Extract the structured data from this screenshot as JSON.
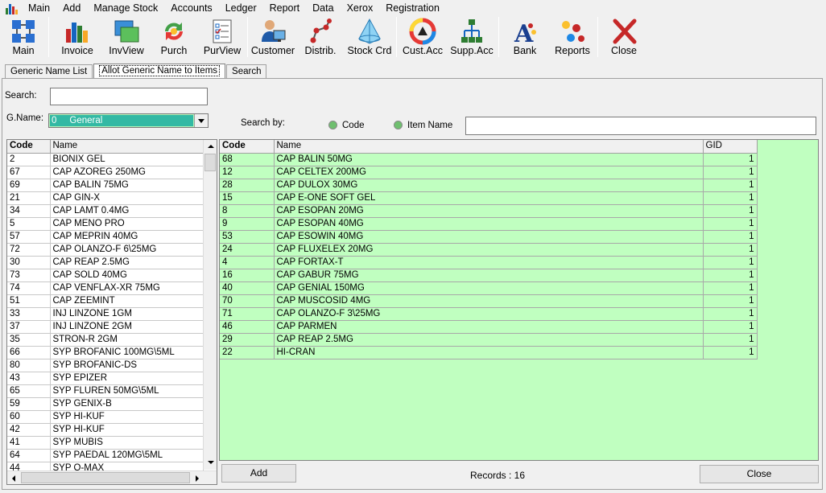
{
  "menu": [
    "Main",
    "Add",
    "Manage Stock",
    "Accounts",
    "Ledger",
    "Report",
    "Data",
    "Xerox",
    "Registration"
  ],
  "toolbar": [
    {
      "label": "Main",
      "icon": "main-icon",
      "group": 0
    },
    {
      "label": "Invoice",
      "icon": "invoice-icon",
      "group": 1
    },
    {
      "label": "InvView",
      "icon": "invview-icon",
      "group": 1
    },
    {
      "label": "Purch",
      "icon": "purch-icon",
      "group": 1
    },
    {
      "label": "PurView",
      "icon": "purview-icon",
      "group": 1
    },
    {
      "label": "Customer",
      "icon": "customer-icon",
      "group": 2
    },
    {
      "label": "Distrib.",
      "icon": "distrib-icon",
      "group": 2
    },
    {
      "label": "Stock Crd",
      "icon": "stock-crd-icon",
      "group": 2
    },
    {
      "label": "Cust.Acc",
      "icon": "cust-acc-icon",
      "group": 3
    },
    {
      "label": "Supp.Acc",
      "icon": "supp-acc-icon",
      "group": 3
    },
    {
      "label": "Bank",
      "icon": "bank-icon",
      "group": 4
    },
    {
      "label": "Reports",
      "icon": "reports-icon",
      "group": 4
    },
    {
      "label": "Close",
      "icon": "close-icon",
      "group": 5
    }
  ],
  "tabs": [
    {
      "label": "Generic Name List",
      "active": false
    },
    {
      "label": "Allot Generic Name to Items",
      "active": true
    },
    {
      "label": "Search",
      "active": false
    }
  ],
  "form": {
    "search_label": "Search:",
    "search_value": "",
    "gname_label": "G.Name:",
    "gname_value": "0     General",
    "search_by_label": "Search by:",
    "radio_code": "Code",
    "radio_item_name": "Item Name",
    "search_by_value": ""
  },
  "left_grid": {
    "columns": [
      "Code",
      "Name"
    ],
    "rows": [
      [
        "2",
        "BIONIX GEL"
      ],
      [
        "67",
        "CAP AZOREG 250MG"
      ],
      [
        "69",
        "CAP BALIN 75MG"
      ],
      [
        "21",
        "CAP GIN-X"
      ],
      [
        "34",
        "CAP LAMT 0.4MG"
      ],
      [
        "5",
        "CAP MENO PRO"
      ],
      [
        "57",
        "CAP MEPRIN 40MG"
      ],
      [
        "72",
        "CAP OLANZO-F  6\\25MG"
      ],
      [
        "30",
        "CAP REAP 2.5MG"
      ],
      [
        "73",
        "CAP SOLD 40MG"
      ],
      [
        "74",
        "CAP VENFLAX-XR 75MG"
      ],
      [
        "51",
        "CAP ZEEMINT"
      ],
      [
        "33",
        "INJ LINZONE 1GM"
      ],
      [
        "37",
        "INJ LINZONE 2GM"
      ],
      [
        "35",
        "STRON-R 2GM"
      ],
      [
        "66",
        "SYP BROFANIC 100MG\\5ML"
      ],
      [
        "80",
        "SYP BROFANIC-DS"
      ],
      [
        "43",
        "SYP EPIZER"
      ],
      [
        "65",
        "SYP FLUREN 50MG\\5ML"
      ],
      [
        "59",
        "SYP GENIX-B"
      ],
      [
        "60",
        "SYP HI-KUF"
      ],
      [
        "42",
        "SYP HI-KUF"
      ],
      [
        "41",
        "SYP MUBIS"
      ],
      [
        "64",
        "SYP PAEDAL 120MG\\5ML"
      ],
      [
        "44",
        "SYP Q-MAX"
      ]
    ]
  },
  "right_grid": {
    "columns": [
      "Code",
      "Name",
      "GID"
    ],
    "rows": [
      [
        "68",
        "CAP BALIN 50MG",
        "1"
      ],
      [
        "12",
        "CAP CELTEX 200MG",
        "1"
      ],
      [
        "28",
        "CAP DULOX 30MG",
        "1"
      ],
      [
        "15",
        "CAP E-ONE SOFT GEL",
        "1"
      ],
      [
        "8",
        "CAP ESOPAN 20MG",
        "1"
      ],
      [
        "9",
        "CAP ESOPAN 40MG",
        "1"
      ],
      [
        "53",
        "CAP ESOWIN 40MG",
        "1"
      ],
      [
        "24",
        "CAP FLUXELEX 20MG",
        "1"
      ],
      [
        "4",
        "CAP FORTAX-T",
        "1"
      ],
      [
        "16",
        "CAP GABUR 75MG",
        "1"
      ],
      [
        "40",
        "CAP GENIAL 150MG",
        "1"
      ],
      [
        "70",
        "CAP MUSCOSID 4MG",
        "1"
      ],
      [
        "71",
        "CAP OLANZO-F  3\\25MG",
        "1"
      ],
      [
        "46",
        "CAP PARMEN",
        "1"
      ],
      [
        "29",
        "CAP REAP 2.5MG",
        "1"
      ],
      [
        "22",
        "HI-CRAN",
        "1"
      ]
    ]
  },
  "footer": {
    "add_label": "Add",
    "records_text": "Records : 16",
    "close_label": "Close"
  },
  "colors": {
    "grid_green": "#c0ffc0",
    "combo_green": "#b7f4b8",
    "selection": "#33b9a4"
  }
}
